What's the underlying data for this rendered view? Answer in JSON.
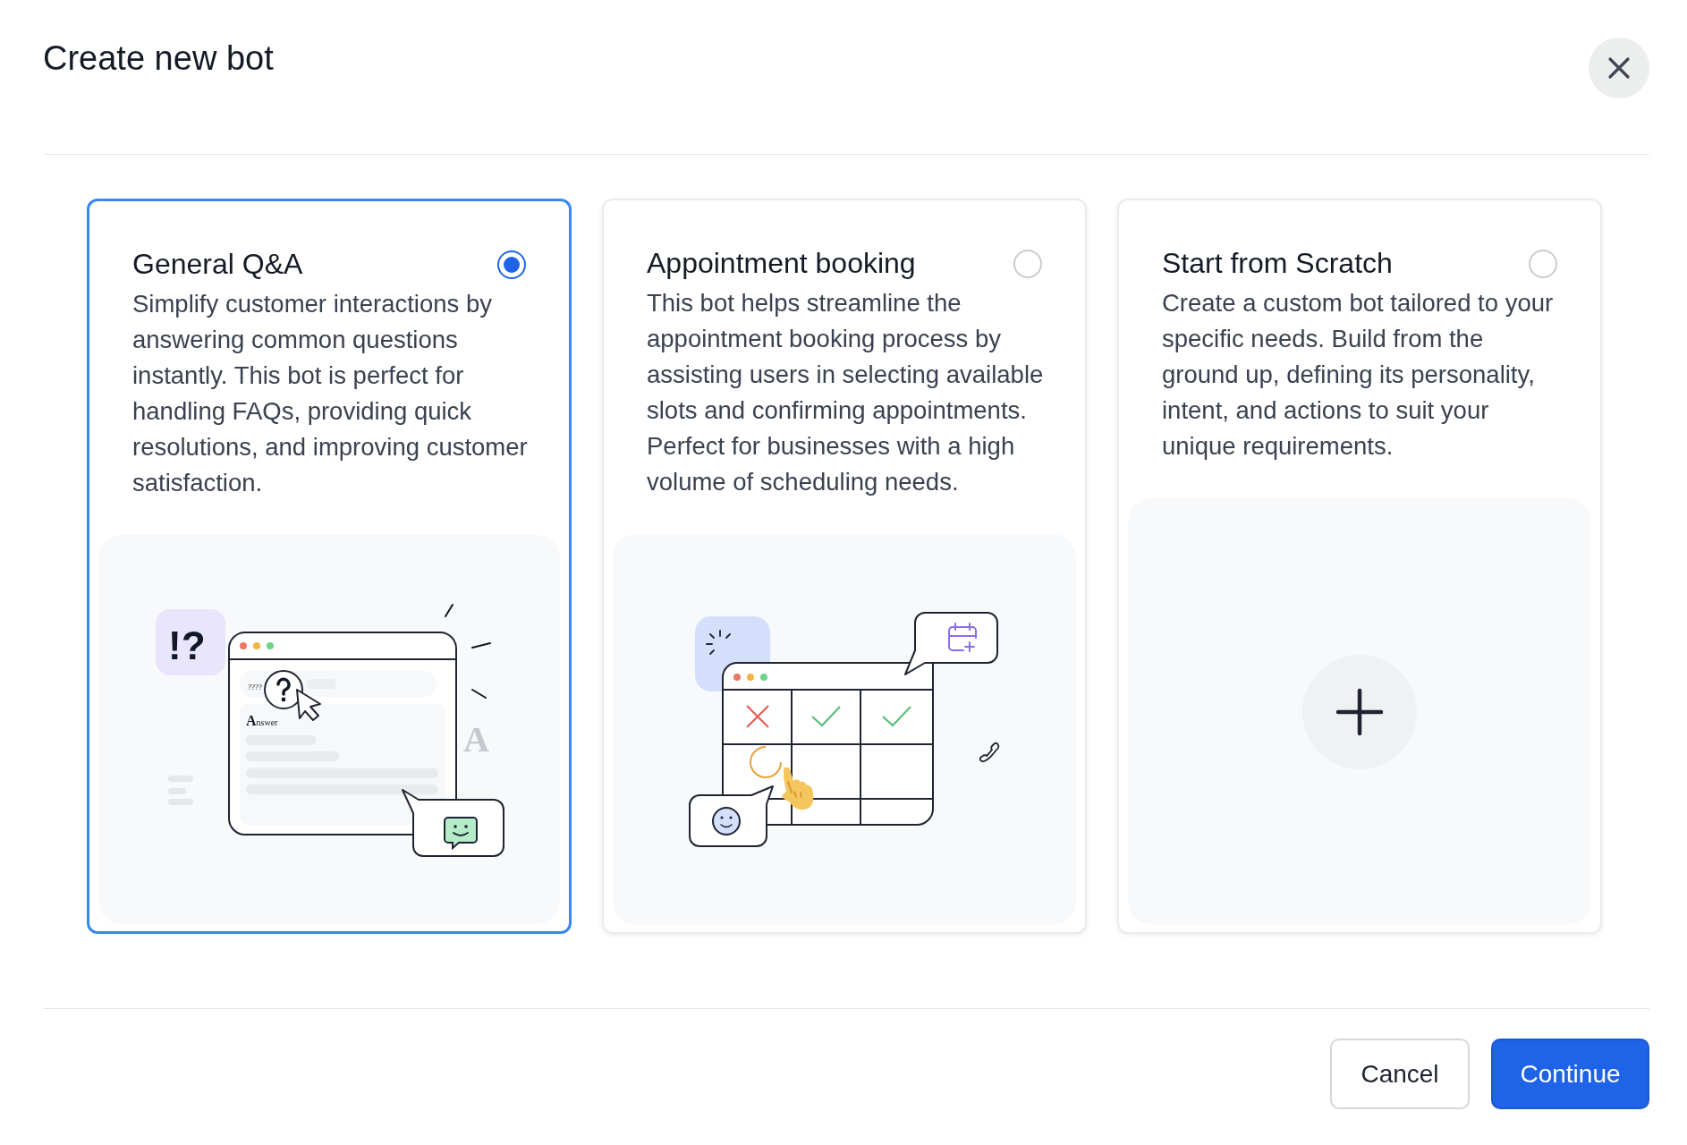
{
  "dialog": {
    "title": "Create new bot"
  },
  "cards": [
    {
      "kind": "qa",
      "title": "General Q&A",
      "selected": true,
      "description": "Simplify customer interactions by answering common questions instantly. This bot is perfect for handling FAQs, providing quick resolutions, and improving customer satisfaction.",
      "illustration": {
        "badge": "!?",
        "query": "????",
        "heading": "Answer",
        "faint_letter": "A"
      }
    },
    {
      "kind": "booking",
      "title": "Appointment booking",
      "selected": false,
      "description": "This bot helps streamline the appointment booking process by assisting users in selecting available slots and confirming appointments. Perfect for businesses with a high volume of scheduling needs."
    },
    {
      "kind": "blank",
      "title": "Start from Scratch",
      "selected": false,
      "description": "Create a custom bot tailored to your specific needs. Build from the ground up, defining its personality, intent, and actions to suit your unique requirements."
    }
  ],
  "buttons": [
    {
      "label": "Cancel",
      "kind": "secondary"
    },
    {
      "label": "Continue",
      "kind": "primary"
    }
  ]
}
